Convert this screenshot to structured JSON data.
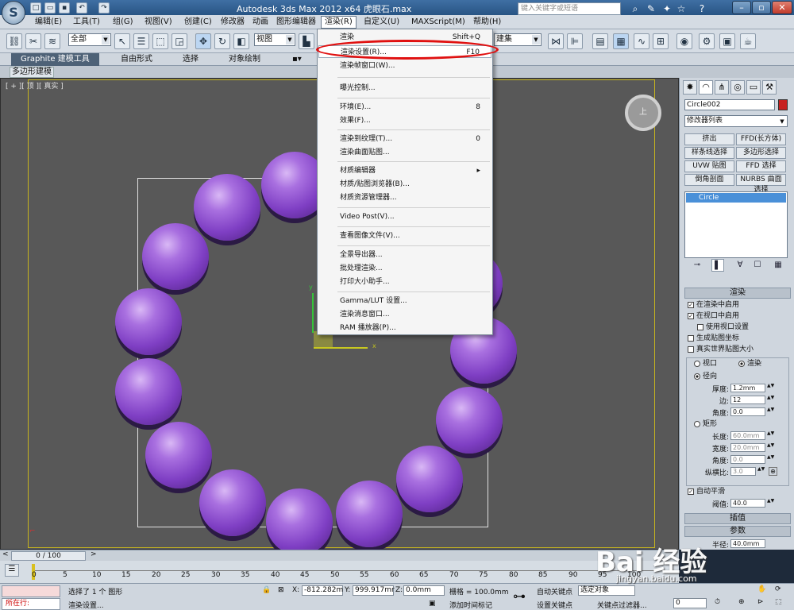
{
  "titlebar": {
    "app_icon": "S",
    "title": "Autodesk 3ds Max  2012 x64      虎眼石.max",
    "search_placeholder": "键入关键字或短语"
  },
  "menubar": {
    "items": [
      "编辑(E)",
      "工具(T)",
      "组(G)",
      "视图(V)",
      "创建(C)",
      "修改器",
      "动画",
      "图形编辑器",
      "渲染(R)",
      "自定义(U)",
      "MAXScript(M)",
      "帮助(H)"
    ]
  },
  "toolbar": {
    "filter_value": "全部",
    "ref_coord_value": "视图",
    "named_sel_value": "建集"
  },
  "ribbon": {
    "tabs": [
      "Graphite 建模工具",
      "自由形式",
      "选择",
      "对象绘制"
    ],
    "sub_label": "多边形建模"
  },
  "viewport": {
    "label": "[ + ][ 顶 ][ 真实 ]",
    "viewcube_label": "上",
    "axis_x": "x",
    "axis_y": "y"
  },
  "render_menu": {
    "items": [
      {
        "label": "渲染",
        "shortcut": "Shift+Q"
      },
      {
        "label": "渲染设置(R)...",
        "shortcut": "F10"
      },
      {
        "label": "渲染帧窗口(W)...",
        "shortcut": ""
      },
      {
        "label": "曝光控制...",
        "shortcut": ""
      },
      {
        "label": "环境(E)...",
        "shortcut": "8"
      },
      {
        "label": "效果(F)...",
        "shortcut": ""
      },
      {
        "label": "渲染到纹理(T)...",
        "shortcut": "0"
      },
      {
        "label": "渲染曲面贴图...",
        "shortcut": ""
      },
      {
        "label": "材质编辑器",
        "shortcut": "▸"
      },
      {
        "label": "材质/贴图浏览器(B)...",
        "shortcut": ""
      },
      {
        "label": "材质资源管理器...",
        "shortcut": ""
      },
      {
        "label": "Video Post(V)...",
        "shortcut": ""
      },
      {
        "label": "查看图像文件(V)...",
        "shortcut": ""
      },
      {
        "label": "全景导出器...",
        "shortcut": ""
      },
      {
        "label": "批处理渲染...",
        "shortcut": ""
      },
      {
        "label": "打印大小助手...",
        "shortcut": ""
      },
      {
        "label": "Gamma/LUT 设置...",
        "shortcut": ""
      },
      {
        "label": "渲染消息窗口...",
        "shortcut": ""
      },
      {
        "label": "RAM 播放器(P)...",
        "shortcut": ""
      }
    ]
  },
  "command_panel": {
    "object_name": "Circle002",
    "object_color": "#c62020",
    "modifier_list": "修改器列表",
    "modifier_buttons": [
      "挤出",
      "FFD(长方体)",
      "样条线选择",
      "多边形选择",
      "UVW 贴图",
      "FFD 选择",
      "倒角剖面",
      "NURBS 曲面选择"
    ],
    "stack_item": "Circle",
    "rollout_title": "渲染",
    "checks": [
      {
        "label": "在渲染中启用",
        "checked": "✓"
      },
      {
        "label": "在视口中启用",
        "checked": "✓"
      },
      {
        "label": "使用视口设置",
        "checked": ""
      },
      {
        "label": "生成贴图坐标",
        "checked": ""
      },
      {
        "label": "真实世界贴图大小",
        "checked": ""
      }
    ],
    "viewport_radio": "视口",
    "render_radio": "渲染",
    "radial_label": "径向",
    "thickness_label": "厚度:",
    "thickness_value": "1.2mm",
    "sides_label": "边:",
    "sides_value": "12",
    "angle_label": "角度:",
    "angle_value": "0.0",
    "rect_label": "矩形",
    "length_label": "长度:",
    "length_value": "60.0mm",
    "width_label": "宽度:",
    "width_value": "20.0mm",
    "angle2_label": "角度:",
    "angle2_value": "0.0",
    "aspect_label": "纵横比:",
    "aspect_value": "3.0",
    "autosmooth_label": "自动平滑",
    "threshold_label": "阈值:",
    "threshold_value": "40.0",
    "interp_label": "插值",
    "params_label": "参数",
    "radius_label": "半径:",
    "radius_value": "40.0mm"
  },
  "timeline": {
    "frame": "0 / 100",
    "ticks": [
      "0",
      "5",
      "10",
      "15",
      "20",
      "25",
      "30",
      "35",
      "40",
      "45",
      "50",
      "55",
      "60",
      "65",
      "70",
      "75",
      "80",
      "85",
      "90",
      "95",
      "100"
    ]
  },
  "status": {
    "running_label": "所在行:",
    "selection": "选择了 1 个 图形",
    "prompt": "渲染设置...",
    "x_label": "X:",
    "x_value": "-812.282m",
    "y_label": "Y:",
    "y_value": "999.917mr",
    "z_label": "Z:",
    "z_value": "0.0mm",
    "grid": "栅格 = 100.0mm",
    "add_time_tag": "添加时间标记",
    "auto_key": "自动关键点",
    "set_key": "设置关键点",
    "selected_obj": "选定对象",
    "key_filters": "关键点过滤器...",
    "frame_value": "0"
  },
  "watermark": {
    "brand": "Bai 经验",
    "url": "jingyan.baidu.com"
  }
}
